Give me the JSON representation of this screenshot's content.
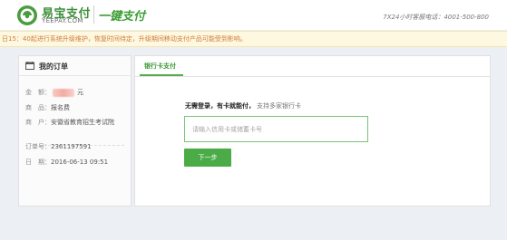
{
  "header": {
    "brand_cn": "易宝支付",
    "brand_en": "YEEPAY.COM",
    "product": "一键支付",
    "hotline": "7X24小时客服电话：4001-500-800",
    "brand_color": "#3e8f3a"
  },
  "notice": {
    "text": "日15：40起进行系统升级维护，恢复时间待定，升级期间移动支付产品可能受到影响。"
  },
  "order": {
    "title": "我的订单",
    "amount_label": "金　额：",
    "amount_unit": "元",
    "product_label": "商　品：",
    "product_value": "报名费",
    "merchant_label": "商　户：",
    "merchant_value": "安徽省教育招生考试院",
    "order_no_label": "订单号：",
    "order_no_value": "2361197591",
    "date_label": "日　期：",
    "date_value": "2016-06-13 09:51"
  },
  "payment": {
    "tab_label": "银行卡支付",
    "headline_bold": "无需登录，有卡就能付，",
    "headline_sub": "支持多家银行卡",
    "card_placeholder": "请输入信用卡或储蓄卡号",
    "next_label": "下一步",
    "accent_color": "#4aab47"
  }
}
